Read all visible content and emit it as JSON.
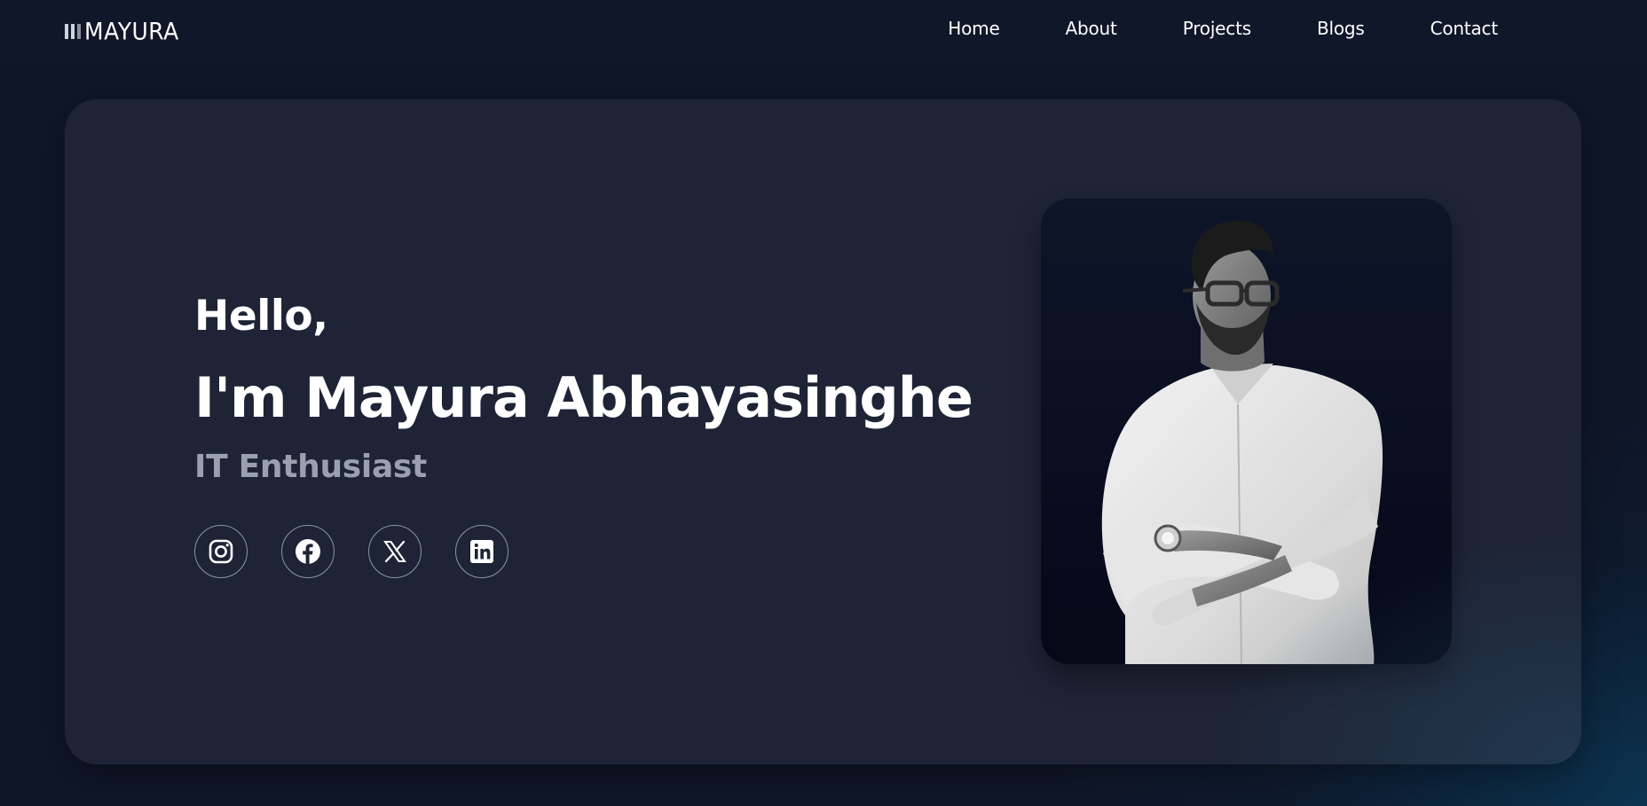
{
  "navbar": {
    "logo_text": "MAYURA",
    "links": [
      {
        "label": "Home"
      },
      {
        "label": "About"
      },
      {
        "label": "Projects"
      },
      {
        "label": "Blogs"
      },
      {
        "label": "Contact"
      }
    ]
  },
  "hero": {
    "greeting": "Hello,",
    "name": "I'm Mayura Abhayasinghe",
    "role": "IT Enthusiast",
    "socials": [
      {
        "icon": "instagram-icon"
      },
      {
        "icon": "facebook-icon"
      },
      {
        "icon": "x-twitter-icon"
      },
      {
        "icon": "linkedin-icon"
      }
    ]
  },
  "colors": {
    "background": "#0f1628",
    "card": "#1e2436",
    "navbar": "#101729",
    "muted_text": "#9aa0ae",
    "text": "#ffffff"
  }
}
